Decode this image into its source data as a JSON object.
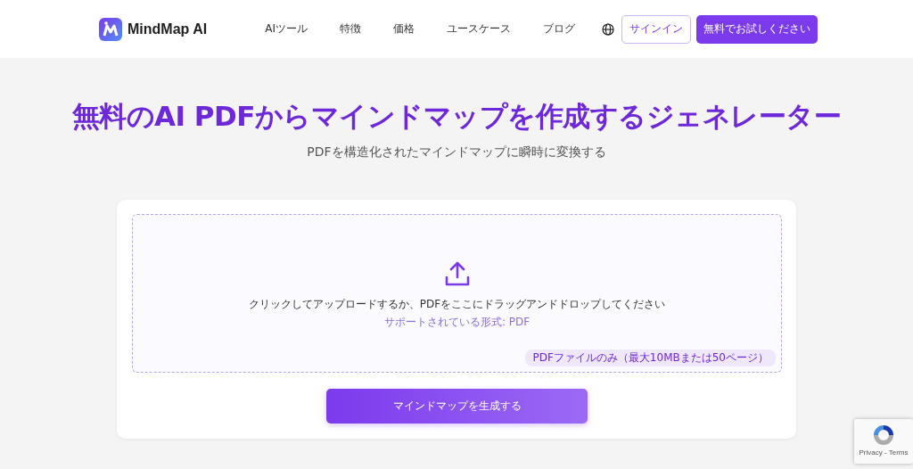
{
  "header": {
    "logo_text": "MindMap AI",
    "nav": [
      "AIツール",
      "特徴",
      "価格",
      "ユースケース",
      "ブログ"
    ],
    "sign_in": "サインイン",
    "try_free": "無料でお試しください"
  },
  "hero": {
    "title": "無料のAI PDFからマインドマップを作成するジェネレーター",
    "subtitle": "PDFを構造化されたマインドマップに瞬時に変換する"
  },
  "upload": {
    "instruction": "クリックしてアップロードするか、PDFをここにドラッグアンドドロップしてください",
    "formats": "サポートされている形式: PDF",
    "limit_badge": "PDFファイルのみ（最大10MBまたは50ページ）",
    "generate_button": "マインドマップを生成する"
  },
  "recaptcha": {
    "links": "Privacy - Terms"
  }
}
